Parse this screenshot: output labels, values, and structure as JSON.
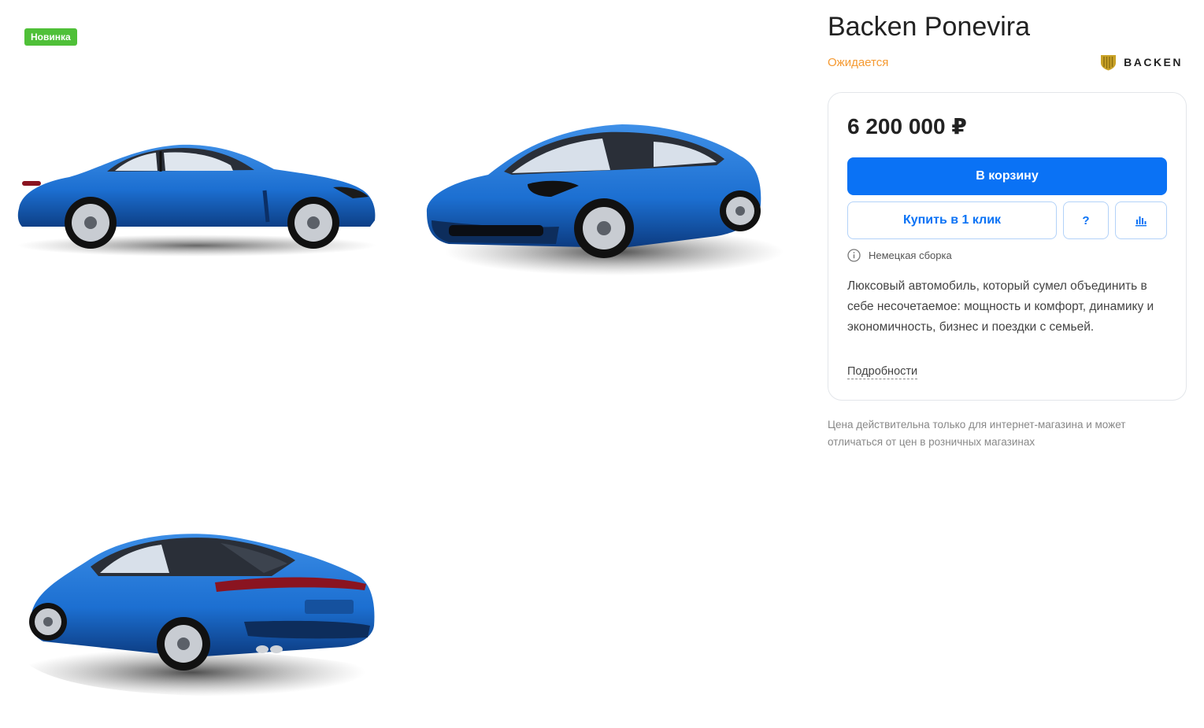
{
  "product": {
    "badge": "Новинка",
    "title": "Backen Ponevira",
    "status": "Ожидается",
    "brand": {
      "name": "BACKEN",
      "logo_icon": "shield-logo-icon",
      "color": "#c9a227"
    },
    "color": "#1c6fd1"
  },
  "card": {
    "price": "6 200 000 ₽",
    "cart_button": "В корзину",
    "one_click_button": "Купить в 1 клик",
    "question_button": "?",
    "compare_icon": "bar-chart-icon",
    "assembly_icon": "info-circle-icon",
    "assembly": "Немецкая сборка",
    "description": "Люксовый автомобиль, который сумел объединить в себе несочетаемое: мощность и комфорт, динамику и экономичность, бизнес и поездки с семьей.",
    "details_link": "Подробности"
  },
  "note": "Цена действительна только для интернет-магазина и может отличаться от цен в розничных магазинах",
  "colors": {
    "accent": "#0a72f5",
    "badge": "#4fc038",
    "status": "#f59a32"
  }
}
